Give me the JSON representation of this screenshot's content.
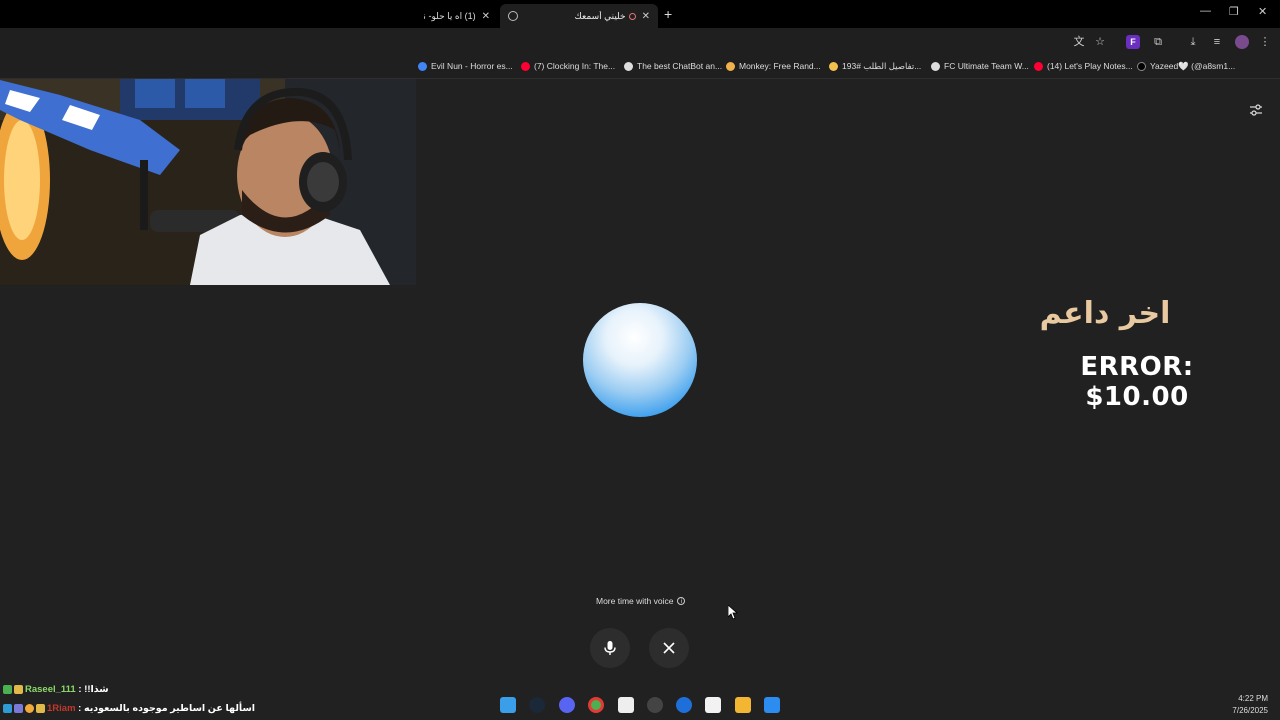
{
  "browser": {
    "tabs": [
      {
        "label": "(1) اه يا حلو- ناي ال",
        "active": false
      },
      {
        "label": "خليني أسمعك",
        "active": true
      }
    ],
    "new_tab": "+",
    "bookmarks": [
      {
        "label": "Evil Nun - Horror es...",
        "color": "#4285f4"
      },
      {
        "label": "(7) Clocking In: The...",
        "color": "#ff0033"
      },
      {
        "label": "The best ChatBot an...",
        "color": "#dddddd"
      },
      {
        "label": "Monkey: Free Rand...",
        "color": "#f0b24c"
      },
      {
        "label": "تفاصيل الطلب #193...",
        "color": "#f2c14e"
      },
      {
        "label": "FC Ultimate Team W...",
        "color": "#dddddd"
      },
      {
        "label": "(14) Let's Play Notes...",
        "color": "#ff0033"
      },
      {
        "label": "Yazeed🤍 (@a8sm1...",
        "color": "#000000"
      }
    ]
  },
  "overlay": {
    "donor_title": "اخر داعم",
    "donor_amount": "ERROR: $10.00"
  },
  "voice": {
    "note": "More time with voice",
    "info_glyph": "i"
  },
  "chat": [
    {
      "user": "Raseel_111",
      "sep": " : ",
      "message": "شذا!!",
      "user_color": "#8bd86a"
    },
    {
      "user": "1Riam",
      "sep": " : ",
      "message": "اسألها عن اساطير موجوده بالسعوديه",
      "user_color": "#c0392b"
    }
  ],
  "clock": {
    "time": "4:22 PM",
    "date": "7/26/2025"
  },
  "colors": {
    "background": "#212121",
    "orb_blue": "#1b86e6",
    "donor_title": "#e8c9a0"
  }
}
